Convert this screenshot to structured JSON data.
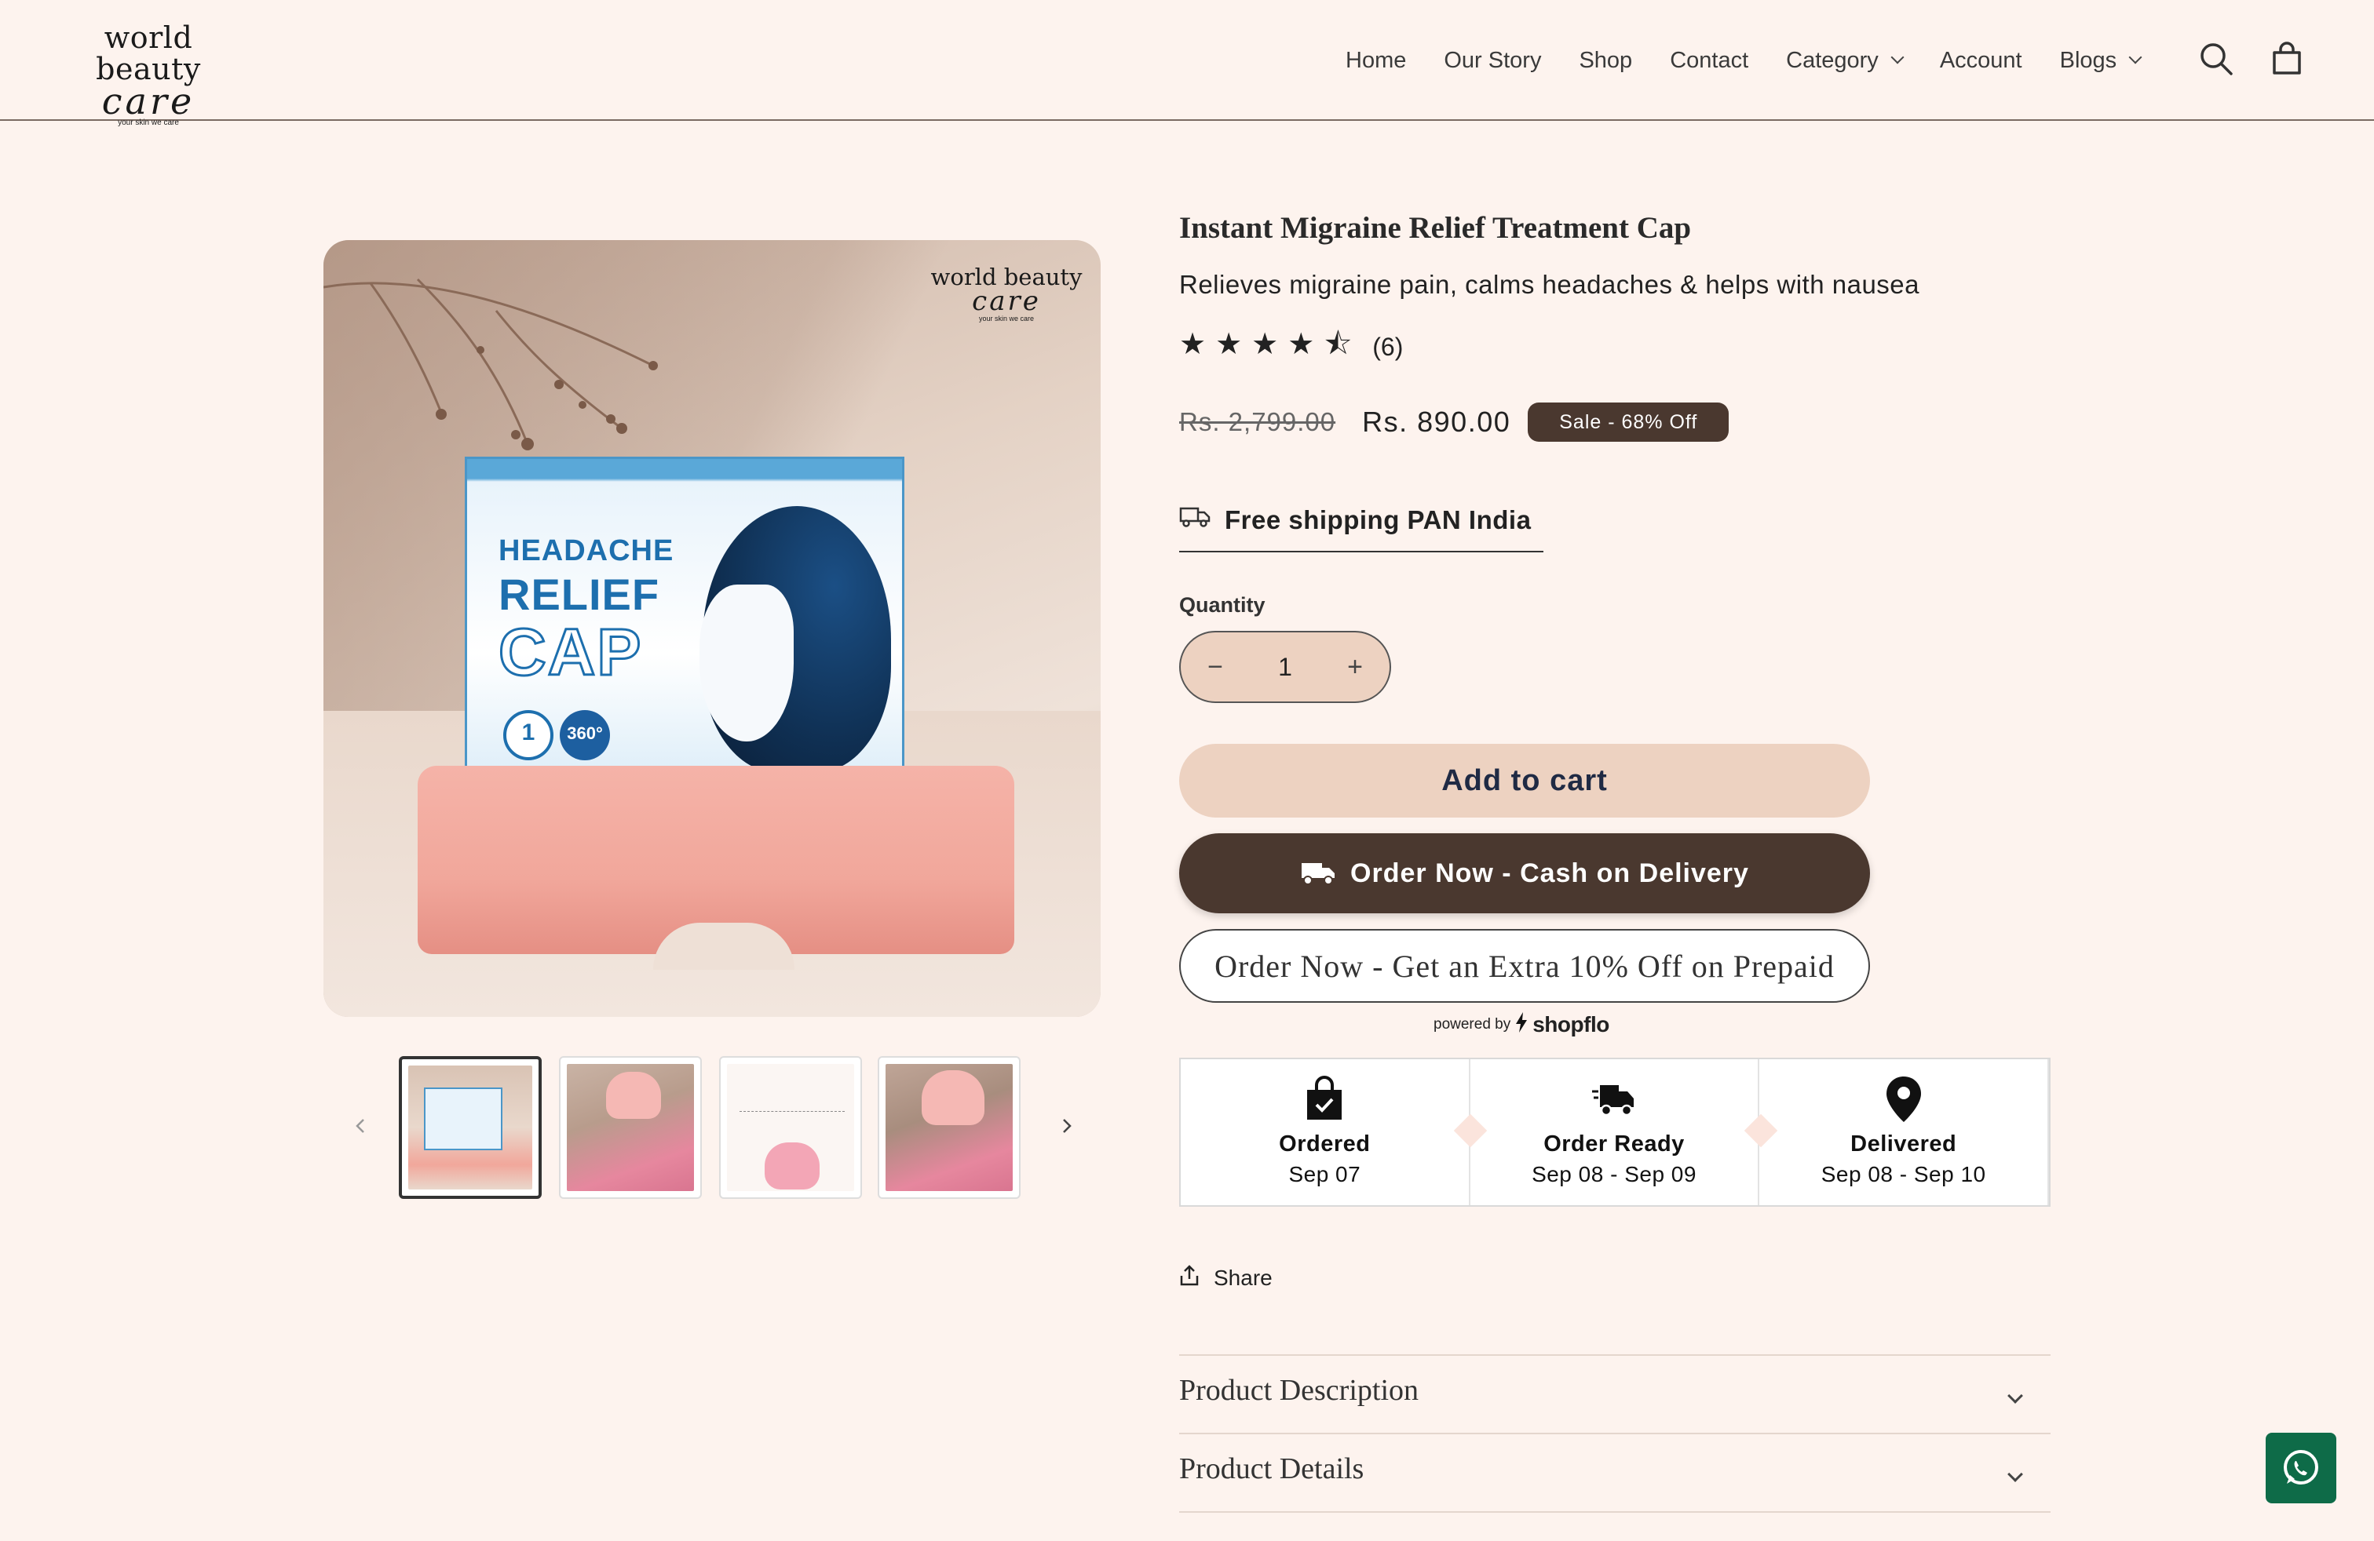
{
  "header": {
    "logo": {
      "line1": "world beauty",
      "line2": "care",
      "tagline": "your skin we care"
    },
    "nav": [
      {
        "label": "Home"
      },
      {
        "label": "Our Story"
      },
      {
        "label": "Shop"
      },
      {
        "label": "Contact"
      },
      {
        "label": "Category",
        "dropdown": true
      },
      {
        "label": "Account"
      },
      {
        "label": "Blogs",
        "dropdown": true
      }
    ],
    "icons": [
      "search-icon",
      "cart-icon"
    ]
  },
  "gallery": {
    "main_image": {
      "logo": {
        "line1": "world beauty",
        "line2": "care",
        "tagline": "your skin we care"
      },
      "box_text": {
        "line1": "HEADACHE",
        "line2": "RELIEF",
        "line3": "CAP",
        "badge1": "1",
        "badge2": "360°"
      }
    },
    "thumbnails": 4,
    "active_thumbnail": 1
  },
  "product": {
    "title": "Instant Migraine Relief Treatment Cap",
    "subtitle": "Relieves migraine pain, calms headaches & helps with nausea",
    "rating": 4.5,
    "rating_stars": "★★★★⯪",
    "review_count": "(6)",
    "price_old": "Rs. 2,799.00",
    "price_new": "Rs. 890.00",
    "sale_badge": "Sale - 68% Off",
    "shipping": "Free shipping PAN India",
    "quantity_label": "Quantity",
    "quantity": "1",
    "add_to_cart": "Add to cart",
    "order_cod": "Order Now - Cash on Delivery",
    "order_prepaid": "Order Now - Get an Extra 10% Off on Prepaid",
    "powered_by": "powered by",
    "powered_brand": "shopflo"
  },
  "tracker": [
    {
      "label": "Ordered",
      "date": "Sep 07",
      "icon": "shopping-bag-check-icon"
    },
    {
      "label": "Order Ready",
      "date": "Sep 08 - Sep 09",
      "icon": "delivery-truck-icon"
    },
    {
      "label": "Delivered",
      "date": "Sep 08 - Sep 10",
      "icon": "location-pin-icon"
    }
  ],
  "share": {
    "label": "Share"
  },
  "accordions": [
    {
      "label": "Product Description"
    },
    {
      "label": "Product Details"
    }
  ],
  "colors": {
    "background": "#fdf3ee",
    "accent_dark": "#4a382f",
    "accent_light": "#edd2c1",
    "whatsapp": "#0e6b48"
  }
}
